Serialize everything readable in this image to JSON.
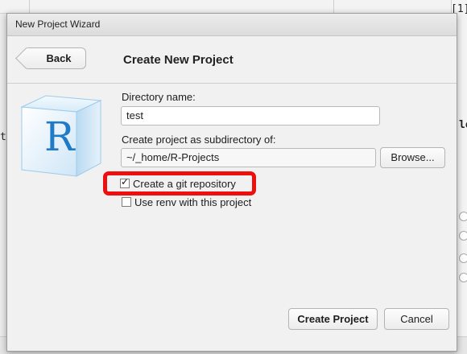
{
  "background": {
    "top_right_text": "[1]",
    "left_text": "t",
    "right_text": "le"
  },
  "dialog": {
    "window_title": "New Project Wizard",
    "back_label": "Back",
    "page_title": "Create New Project",
    "directory_label": "Directory name:",
    "directory_value": "test",
    "subdir_label": "Create project as subdirectory of:",
    "subdir_value": "~/_home/R-Projects",
    "browse_label": "Browse...",
    "git_checkbox": {
      "label": "Create a git repository",
      "checked": true
    },
    "renv_checkbox": {
      "label": "Use renv with this project",
      "checked": false
    },
    "create_label": "Create Project",
    "cancel_label": "Cancel",
    "icon_letter": "R",
    "highlight_color": "#ee0f0f"
  }
}
